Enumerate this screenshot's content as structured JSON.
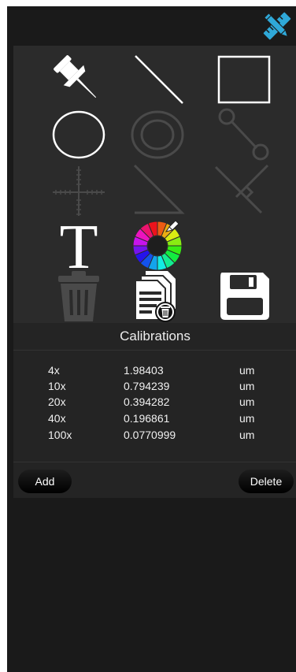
{
  "toolbar": {
    "toggle_icon": "ruler-pencil-icon",
    "accent_color": "#2fa8d8"
  },
  "tools": [
    {
      "name": "pin-tool",
      "icon": "pushpin-icon",
      "enabled": true
    },
    {
      "name": "line-tool",
      "icon": "line-icon",
      "enabled": true
    },
    {
      "name": "rectangle-tool",
      "icon": "rectangle-icon",
      "enabled": true
    },
    {
      "name": "ellipse-tool",
      "icon": "ellipse-icon",
      "enabled": true
    },
    {
      "name": "concentric-circle-tool",
      "icon": "concentric-circles-icon",
      "enabled": false
    },
    {
      "name": "circle-line-tool",
      "icon": "circle-line-icon",
      "enabled": false
    },
    {
      "name": "crosshair-tool",
      "icon": "crosshair-scale-icon",
      "enabled": false
    },
    {
      "name": "angle-tool",
      "icon": "angle-icon",
      "enabled": false
    },
    {
      "name": "perpendicular-tool",
      "icon": "perpendicular-icon",
      "enabled": false
    },
    {
      "name": "text-tool",
      "icon": "text-t-icon",
      "enabled": true,
      "glyph": "T"
    },
    {
      "name": "color-picker",
      "icon": "color-wheel-icon",
      "enabled": true
    },
    {
      "name": "delete-tool",
      "icon": "trash-icon",
      "enabled": false
    },
    {
      "name": "clear-pages-tool",
      "icon": "documents-trash-icon",
      "enabled": true
    },
    {
      "name": "save-tool",
      "icon": "floppy-disk-icon",
      "enabled": true
    }
  ],
  "calibrations": {
    "title": "Calibrations",
    "rows": [
      {
        "mag": "4x",
        "value": "1.98403",
        "unit": "um"
      },
      {
        "mag": "10x",
        "value": "0.794239",
        "unit": "um"
      },
      {
        "mag": "20x",
        "value": "0.394282",
        "unit": "um"
      },
      {
        "mag": "40x",
        "value": "0.196861",
        "unit": "um"
      },
      {
        "mag": "100x",
        "value": "0.0770999",
        "unit": "um"
      }
    ],
    "add_label": "Add",
    "delete_label": "Delete"
  }
}
